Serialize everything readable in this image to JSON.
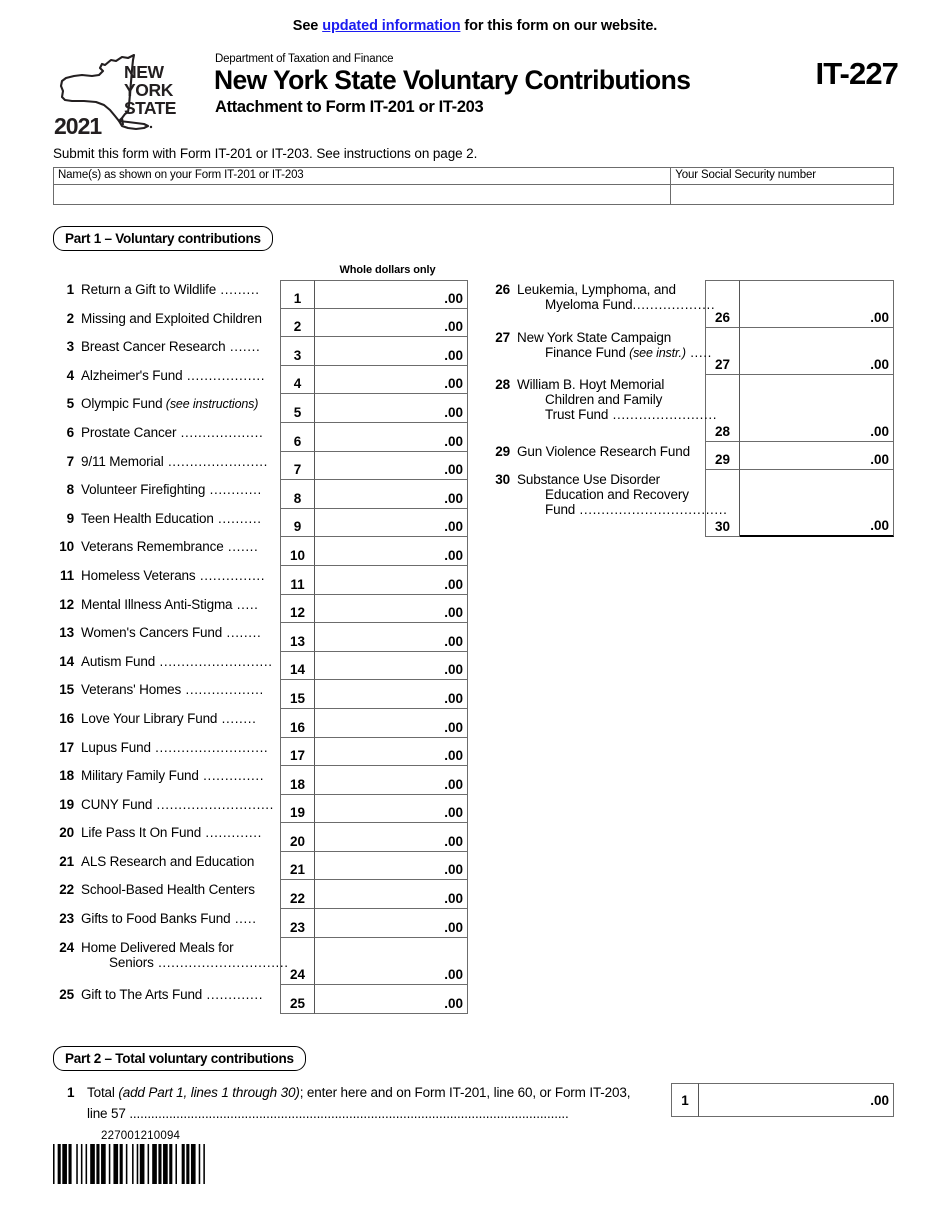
{
  "notice": {
    "pre": "See ",
    "link": "updated information",
    "post": " for this form on our website."
  },
  "header": {
    "logo_state_line1": "NEW",
    "logo_state_line2": "YORK",
    "logo_state_line3": "STATE",
    "logo_year": "2021",
    "department": "Department of Taxation and Finance",
    "title": "New York State Voluntary Contributions",
    "subtitle": "Attachment to Form IT-201 or IT-203",
    "form_number": "IT-227"
  },
  "submit_line": "Submit this form with Form IT-201 or IT-203. See instructions on page 2.",
  "identification": {
    "name_caption": "Name(s) as shown on your Form IT-201 or IT-203",
    "name_value": "",
    "ssn_caption": "Your Social Security number",
    "ssn_value": ""
  },
  "part1": {
    "banner": "Part 1 – Voluntary contributions",
    "column_header": "Whole dollars only",
    "left_lines": [
      {
        "no": "1",
        "text": "Return a Gift to Wildlife",
        "dots": " .........",
        "indent": false,
        "italic": "",
        "amount": ".00"
      },
      {
        "no": "2",
        "text": "Missing and Exploited Children",
        "dots": "",
        "indent": false,
        "italic": "",
        "amount": ".00"
      },
      {
        "no": "3",
        "text": "Breast Cancer Research",
        "dots": " .......",
        "indent": false,
        "italic": "",
        "amount": ".00"
      },
      {
        "no": "4",
        "text": "Alzheimer's Fund",
        "dots": "  ..................",
        "indent": false,
        "italic": "",
        "amount": ".00"
      },
      {
        "no": "5",
        "text": "Olympic Fund",
        "dots": "",
        "indent": false,
        "italic": " (see instructions)",
        "amount": ".00"
      },
      {
        "no": "6",
        "text": "Prostate Cancer",
        "dots": "  ...................",
        "indent": false,
        "italic": "",
        "amount": ".00"
      },
      {
        "no": "7",
        "text": "9/11 Memorial",
        "dots": " .......................",
        "indent": false,
        "italic": "",
        "amount": ".00"
      },
      {
        "no": "8",
        "text": "Volunteer Firefighting",
        "dots": "  ............",
        "indent": false,
        "italic": "",
        "amount": ".00"
      },
      {
        "no": "9",
        "text": "Teen Health Education",
        "dots": "  ..........",
        "indent": false,
        "italic": "",
        "amount": ".00"
      },
      {
        "no": "10",
        "text": "Veterans Remembrance",
        "dots": "  .......",
        "indent": false,
        "italic": "",
        "amount": ".00"
      },
      {
        "no": "11",
        "text": "Homeless Veterans",
        "dots": "  ...............",
        "indent": false,
        "italic": "",
        "amount": ".00"
      },
      {
        "no": "12",
        "text": "Mental Illness Anti-Stigma",
        "dots": " .....",
        "indent": false,
        "italic": "",
        "amount": ".00"
      },
      {
        "no": "13",
        "text": "Women's Cancers Fund",
        "dots": " ........",
        "indent": false,
        "italic": "",
        "amount": ".00"
      },
      {
        "no": "14",
        "text": "Autism Fund",
        "dots": " ..........................",
        "indent": false,
        "italic": "",
        "amount": ".00"
      },
      {
        "no": "15",
        "text": "Veterans' Homes",
        "dots": " ..................",
        "indent": false,
        "italic": "",
        "amount": ".00"
      },
      {
        "no": "16",
        "text": "Love Your Library Fund",
        "dots": "  ........",
        "indent": false,
        "italic": "",
        "amount": ".00"
      },
      {
        "no": "17",
        "text": "Lupus Fund",
        "dots": "  ..........................",
        "indent": false,
        "italic": "",
        "amount": ".00"
      },
      {
        "no": "18",
        "text": "Military Family Fund",
        "dots": "  ..............",
        "indent": false,
        "italic": "",
        "amount": ".00"
      },
      {
        "no": "19",
        "text": "CUNY Fund",
        "dots": " ...........................",
        "indent": false,
        "italic": "",
        "amount": ".00"
      },
      {
        "no": "20",
        "text": "Life Pass It On Fund",
        "dots": "  .............",
        "indent": false,
        "italic": "",
        "amount": ".00"
      },
      {
        "no": "21",
        "text": "ALS Research and Education",
        "dots": "",
        "indent": false,
        "italic": "",
        "amount": ".00"
      },
      {
        "no": "22",
        "text": "School-Based Health Centers",
        "dots": "",
        "indent": false,
        "italic": "",
        "amount": ".00"
      },
      {
        "no": "23",
        "text": "Gifts to Food Banks Fund",
        "dots": "  .....",
        "indent": false,
        "italic": "",
        "amount": ".00"
      },
      {
        "no": "24",
        "text": "Home Delivered Meals for",
        "text2": "Seniors",
        "dots2": "  ..............................",
        "dots": "",
        "indent": false,
        "italic": "",
        "amount": ".00"
      },
      {
        "no": "25",
        "text": "Gift to The Arts Fund",
        "dots": "  .............",
        "indent": false,
        "italic": "",
        "amount": ".00"
      }
    ],
    "right_lines": [
      {
        "no": "26",
        "text": "Leukemia, Lymphoma, and",
        "text2": "Myeloma Fund",
        "dots2": "...................",
        "amount": ".00"
      },
      {
        "no": "27",
        "text": "New York State Campaign",
        "text2": "Finance Fund",
        "italic2": " (see instr.)",
        "dots2": " .....",
        "amount": ".00"
      },
      {
        "no": "28",
        "text": "William B. Hoyt Memorial",
        "text2": "Children and Family",
        "text3": "Trust Fund",
        "dots3": "  ........................",
        "amount": ".00"
      },
      {
        "no": "29",
        "text": "Gun Violence Research Fund",
        "amount": ".00"
      },
      {
        "no": "30",
        "text": "Substance Use Disorder",
        "text2": "Education and Recovery",
        "text3": "Fund",
        "dots3": "  ..................................",
        "amount": ".00"
      }
    ]
  },
  "part2": {
    "banner": "Part 2 – Total voluntary contributions",
    "line_no": "1",
    "text_a": "Total ",
    "text_italic": "(add Part 1, lines 1 through 30)",
    "text_b": "; enter here and on Form IT-201, line 60, or Form IT-203,",
    "text_line2": "line 57 ..........................................................................................................................",
    "box_no": "1",
    "amount": ".00"
  },
  "footer": {
    "barcode_number": "227001210094"
  },
  "colors": {
    "link": "#1c1cf0",
    "rule": "#6c6c6c",
    "text": "#000000"
  }
}
